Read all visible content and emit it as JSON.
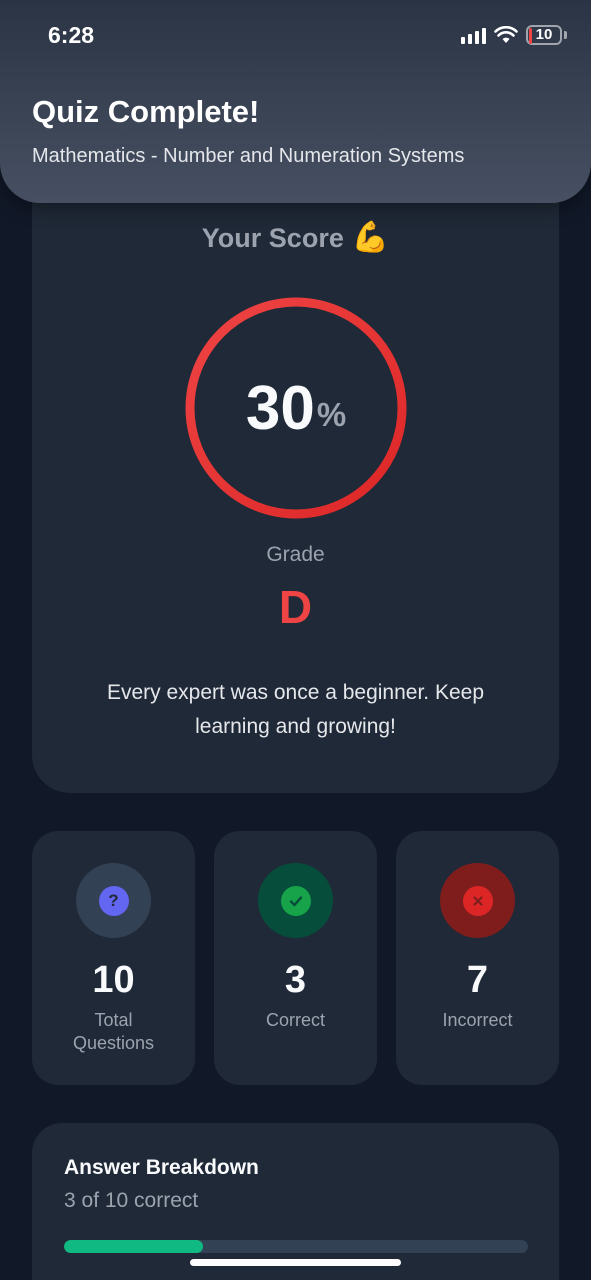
{
  "status_bar": {
    "time": "6:28",
    "battery_level": "10",
    "battery_color": "#ef4444"
  },
  "header": {
    "title": "Quiz Complete!",
    "subtitle": "Mathematics - Number and Numeration Systems"
  },
  "score_card": {
    "heading": "Your Score",
    "emoji": "💪",
    "score_value": "30",
    "score_percent_sign": "%",
    "score_fraction": 0.3,
    "ring_color": "#e53935",
    "grade_label": "Grade",
    "grade": "D",
    "message": "Every expert was once a beginner. Keep learning and growing!"
  },
  "stats": [
    {
      "icon": "question-icon",
      "value": "10",
      "label": "Total Questions",
      "icon_bg": "#334155",
      "icon_color": "#6366f1"
    },
    {
      "icon": "check-icon",
      "value": "3",
      "label": "Correct",
      "icon_bg": "#064e3b",
      "icon_color": "#16a34a"
    },
    {
      "icon": "x-icon",
      "value": "7",
      "label": "Incorrect",
      "icon_bg": "#7f1d1d",
      "icon_color": "#dc2626"
    }
  ],
  "breakdown": {
    "title": "Answer Breakdown",
    "subtitle": "3 of 10 correct",
    "progress_fraction": 0.3,
    "progress_color": "#10b981"
  }
}
